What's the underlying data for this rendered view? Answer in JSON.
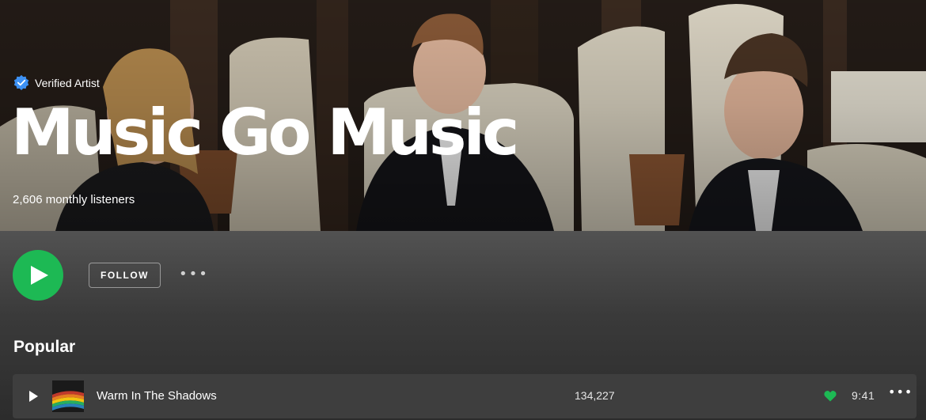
{
  "artist": {
    "verified_label": "Verified Artist",
    "name": "Music Go Music",
    "monthly_listeners": "2,606 monthly listeners"
  },
  "actions": {
    "follow_label": "FOLLOW",
    "more_label": "•••"
  },
  "popular": {
    "title": "Popular",
    "tracks": [
      {
        "title": "Warm In The Shadows",
        "plays": "134,227",
        "duration": "9:41",
        "liked": true,
        "more": "•••"
      }
    ]
  },
  "colors": {
    "accent": "#1db954",
    "verified_badge": "#3d91f4"
  },
  "icons": [
    "verified-badge-icon",
    "play-icon",
    "heart-icon",
    "more-icon"
  ]
}
